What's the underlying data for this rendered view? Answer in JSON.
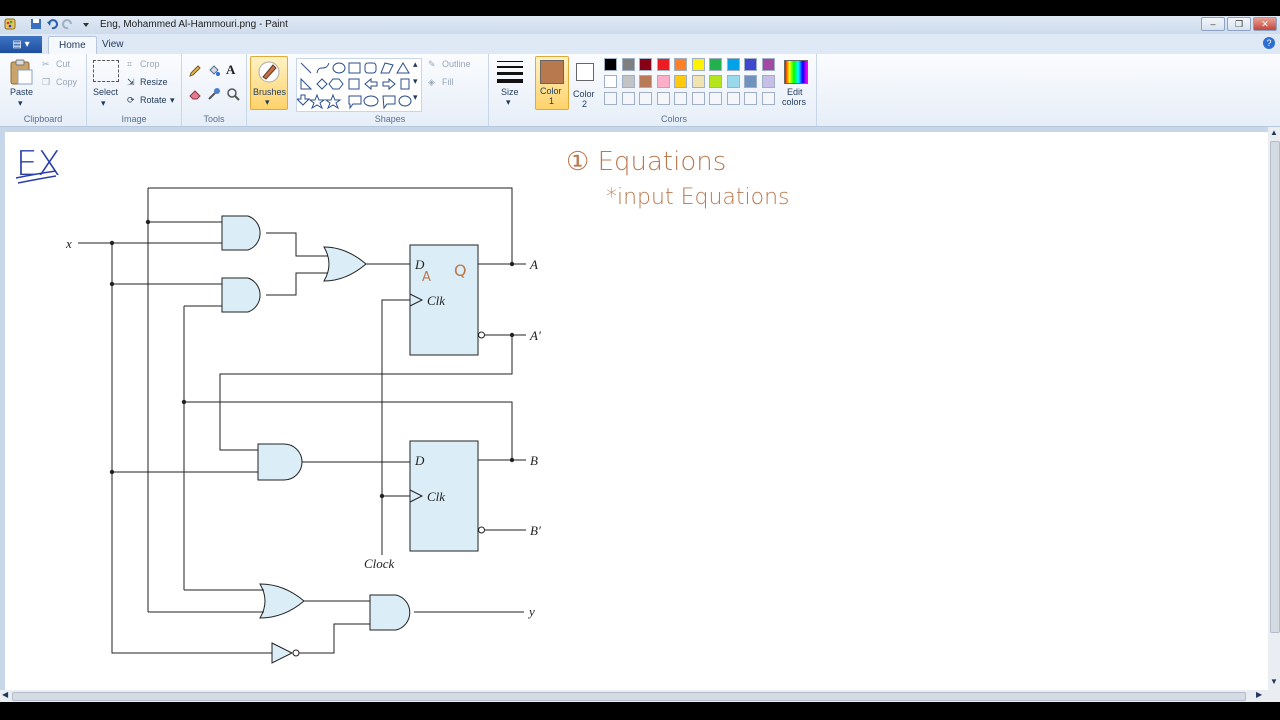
{
  "window": {
    "title": "Eng, Mohammed Al-Hammouri.png - Paint",
    "buttons": [
      "–",
      "❐",
      "✕"
    ]
  },
  "tabs": {
    "file_label": "▤ ▾",
    "home": "Home",
    "view": "View",
    "help": "?"
  },
  "ribbon": {
    "clipboard": {
      "paste": "Paste",
      "cut": "Cut",
      "copy": "Copy",
      "label": "Clipboard"
    },
    "image": {
      "select": "Select",
      "crop": "Crop",
      "resize": "Resize",
      "rotate": "Rotate",
      "label": "Image"
    },
    "tools": {
      "label": "Tools"
    },
    "brushes": {
      "label": "Brushes"
    },
    "shapes": {
      "outline": "Outline",
      "fill": "Fill",
      "label": "Shapes"
    },
    "size": {
      "label": "Size"
    },
    "color1": {
      "label": "Color",
      "num": "1",
      "color": "#b9794f"
    },
    "color2": {
      "label": "Color",
      "num": "2",
      "color": "#ffffff"
    },
    "colors_label": "Colors",
    "edit_colors": {
      "line1": "Edit",
      "line2": "colors"
    },
    "palette_row1": [
      "#000000",
      "#7f7f7f",
      "#880015",
      "#ed1c24",
      "#ff7f27",
      "#fff200",
      "#22b14c",
      "#00a2e8",
      "#3f48cc",
      "#a349a4"
    ],
    "palette_row2": [
      "#ffffff",
      "#c3c3c3",
      "#b97a57",
      "#ffaec9",
      "#ffc90e",
      "#efe4b0",
      "#b5e61d",
      "#99d9ea",
      "#7092be",
      "#c8bfe7"
    ]
  },
  "canvas": {
    "ex_label": "EX",
    "handwriting": {
      "line1": "① Equations",
      "line2": "*input Equations",
      "d_annotation": "A",
      "q_annotation": "Q"
    },
    "circuit": {
      "input_x": "x",
      "output_A": "A",
      "output_A_bar": "A′",
      "output_B": "B",
      "output_B_bar": "B′",
      "output_y": "y",
      "clock": "Clock",
      "ff1_d": "D",
      "ff1_clk": "Clk",
      "ff2_d": "D",
      "ff2_clk": "Clk"
    }
  }
}
